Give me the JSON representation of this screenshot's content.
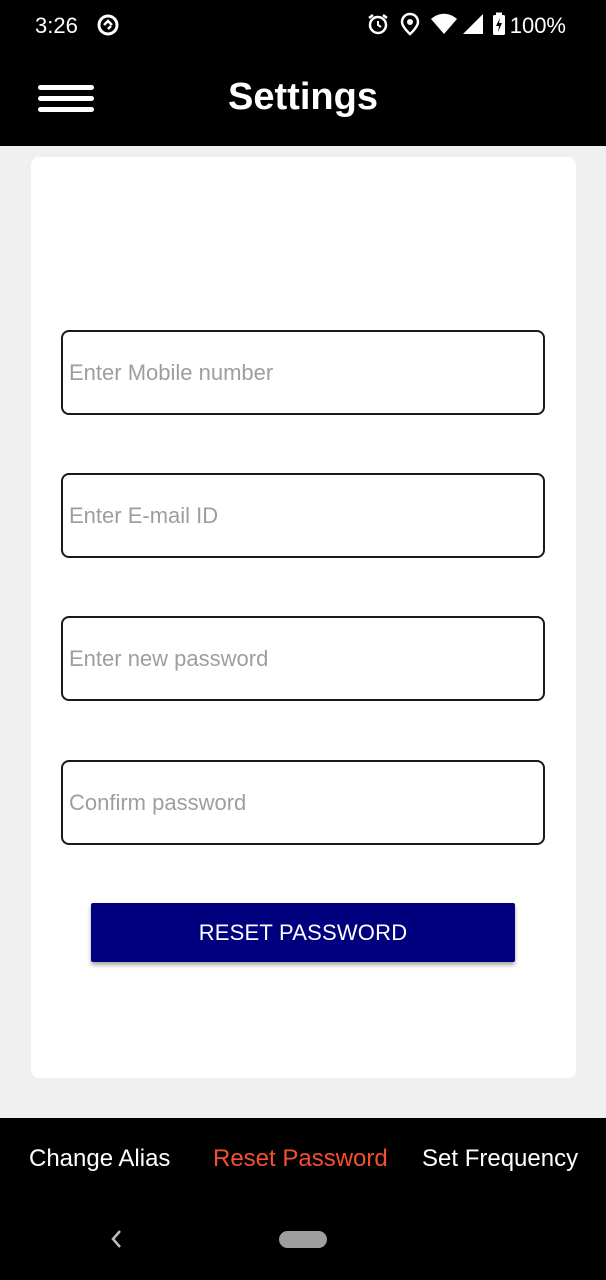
{
  "status_bar": {
    "time": "3:26",
    "battery": "100%",
    "icons": [
      "sync-icon",
      "alarm-icon",
      "location-icon",
      "wifi-icon",
      "signal-icon",
      "battery-charging-icon"
    ]
  },
  "app_bar": {
    "title": "Settings",
    "menu_icon": "hamburger-menu-icon"
  },
  "form": {
    "mobile_placeholder": "Enter Mobile number",
    "email_placeholder": "Enter E-mail ID",
    "new_password_placeholder": "Enter new password",
    "confirm_password_placeholder": "Confirm password",
    "submit_label": "RESET PASSWORD"
  },
  "bottom_tabs": {
    "items": [
      {
        "label": "Change Alias",
        "active": false
      },
      {
        "label": "Reset Password",
        "active": true
      },
      {
        "label": "Set Frequency",
        "active": false
      }
    ]
  },
  "colors": {
    "app_bar": "#000000",
    "button": "#00007f",
    "active_tab": "#f4502f",
    "background": "#f0f0f0"
  }
}
